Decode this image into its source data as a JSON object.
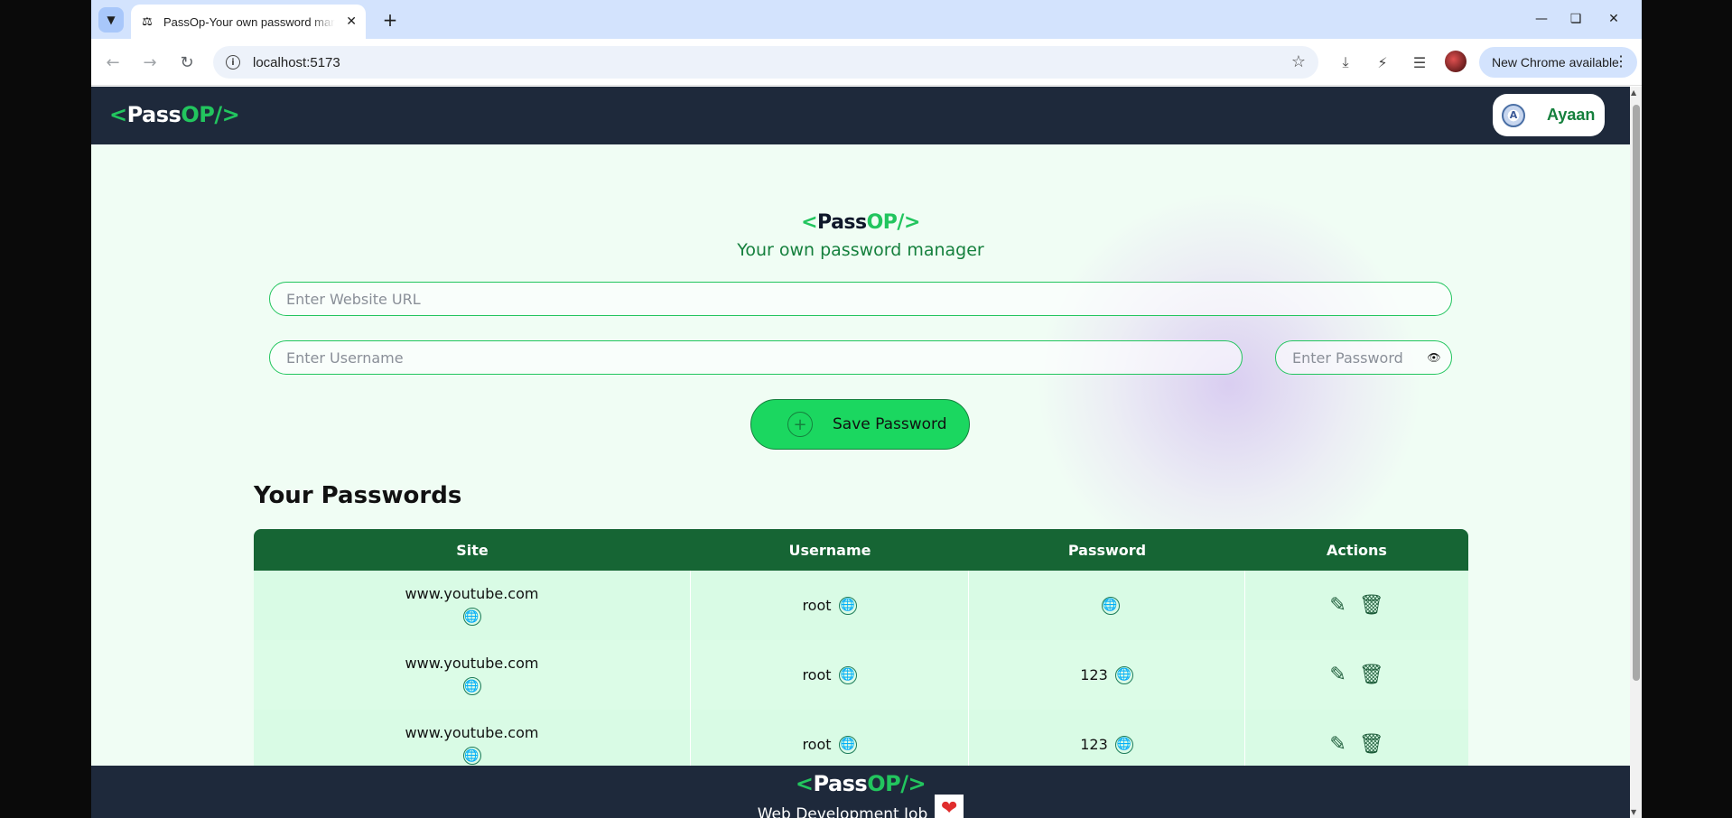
{
  "browser": {
    "tab_title": "PassOp-Your own password manager",
    "url": "localhost:5173",
    "update_label": "New Chrome available"
  },
  "app": {
    "logo": {
      "open": "<",
      "pass": "Pass",
      "op": "OP/>"
    },
    "user_name": "Ayaan",
    "avatar_letter": "A"
  },
  "hero": {
    "subtitle": "Your own password manager"
  },
  "form": {
    "url_placeholder": "Enter Website URL",
    "username_placeholder": "Enter Username",
    "password_placeholder": "Enter Password",
    "save_label": "Save Password"
  },
  "passwords": {
    "title": "Your Passwords",
    "columns": [
      "Site",
      "Username",
      "Password",
      "Actions"
    ],
    "rows": [
      {
        "site": "www.youtube.com",
        "username": "root",
        "password": ""
      },
      {
        "site": "www.youtube.com",
        "username": "root",
        "password": "123"
      },
      {
        "site": "www.youtube.com",
        "username": "root",
        "password": "123"
      }
    ]
  },
  "footer": {
    "made_with": "Web Development Job"
  },
  "colors": {
    "nav_bg": "#1e293b",
    "accent_green": "#22c55e",
    "table_header": "#166534",
    "row_bg": "#dcfce7",
    "button_green": "#1bd760"
  }
}
